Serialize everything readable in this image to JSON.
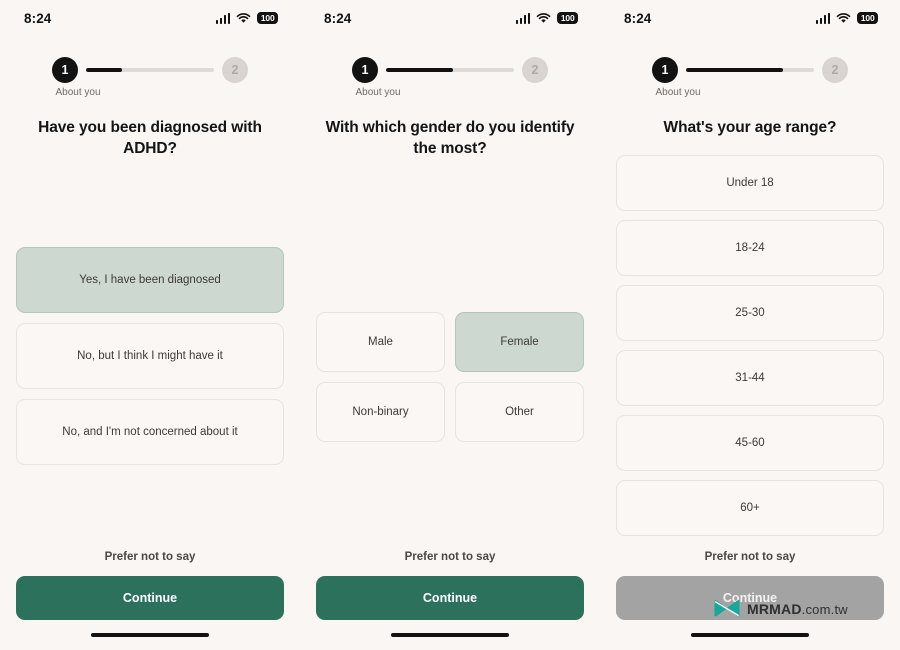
{
  "status_bar": {
    "time": "8:24",
    "battery": "100",
    "signal_icon": "cellular-signal-icon",
    "wifi_icon": "wifi-icon",
    "battery_icon": "battery-icon"
  },
  "progress": {
    "current_step": "1",
    "next_step": "2",
    "label": "About you"
  },
  "panels": [
    {
      "id": "adhd-diagnosis",
      "progress_percent": 28,
      "question": "Have you been diagnosed with ADHD?",
      "layout": "stack",
      "options": [
        {
          "label": "Yes, I have been diagnosed",
          "selected": true
        },
        {
          "label": "No, but I think I might have it",
          "selected": false
        },
        {
          "label": "No, and I'm not concerned about it",
          "selected": false
        }
      ],
      "prefer_label": "Prefer not to say",
      "continue_label": "Continue",
      "continue_enabled": true
    },
    {
      "id": "gender-identity",
      "progress_percent": 52,
      "question": "With which gender do you identify the most?",
      "layout": "grid2",
      "options": [
        {
          "label": "Male",
          "selected": false
        },
        {
          "label": "Female",
          "selected": true
        },
        {
          "label": "Non-binary",
          "selected": false
        },
        {
          "label": "Other",
          "selected": false
        }
      ],
      "prefer_label": "Prefer not to say",
      "continue_label": "Continue",
      "continue_enabled": true
    },
    {
      "id": "age-range",
      "progress_percent": 76,
      "question": "What's your age range?",
      "layout": "stack",
      "options": [
        {
          "label": "Under 18",
          "selected": false
        },
        {
          "label": "18-24",
          "selected": false
        },
        {
          "label": "25-30",
          "selected": false
        },
        {
          "label": "31-44",
          "selected": false
        },
        {
          "label": "45-60",
          "selected": false
        },
        {
          "label": "60+",
          "selected": false
        }
      ],
      "prefer_label": "Prefer not to say",
      "continue_label": "Continue",
      "continue_enabled": false
    }
  ],
  "watermark": {
    "name": "MRMAD",
    "tld": ".com.tw",
    "logo_color": "#17a79b"
  },
  "colors": {
    "background": "#faf6f4",
    "selected_option": "#ccd8d0",
    "continue_enabled": "#2b715b",
    "continue_disabled": "#a3a3a3",
    "text_primary": "#141414"
  }
}
